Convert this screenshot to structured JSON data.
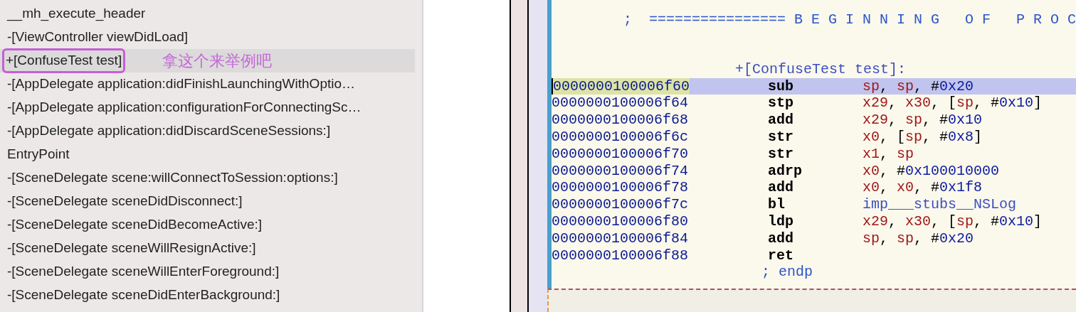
{
  "symbols": {
    "items": [
      {
        "label": "__mh_execute_header",
        "selected": false
      },
      {
        "label": "-[ViewController viewDidLoad]",
        "selected": false
      },
      {
        "label": "+[ConfuseTest test]",
        "selected": true,
        "circled": true,
        "note": "拿这个来举例吧"
      },
      {
        "label": "-[AppDelegate application:didFinishLaunchingWithOptio…",
        "selected": false
      },
      {
        "label": "-[AppDelegate application:configurationForConnectingSc…",
        "selected": false
      },
      {
        "label": "-[AppDelegate application:didDiscardSceneSessions:]",
        "selected": false
      },
      {
        "label": "EntryPoint",
        "selected": false
      },
      {
        "label": "-[SceneDelegate scene:willConnectToSession:options:]",
        "selected": false
      },
      {
        "label": "-[SceneDelegate sceneDidDisconnect:]",
        "selected": false
      },
      {
        "label": "-[SceneDelegate sceneDidBecomeActive:]",
        "selected": false
      },
      {
        "label": "-[SceneDelegate sceneWillResignActive:]",
        "selected": false
      },
      {
        "label": "-[SceneDelegate sceneWillEnterForeground:]",
        "selected": false
      },
      {
        "label": "-[SceneDelegate sceneDidEnterBackground:]",
        "selected": false
      }
    ]
  },
  "disassembly": {
    "banner": ";  ================ B E G I N N I N G   O F   P R O C",
    "procedure_label": "+[ConfuseTest test]:",
    "lines": [
      {
        "address": "0000000100006f60",
        "mnemonic": "sub",
        "selected": true,
        "operands": [
          {
            "text": "sp",
            "kind": "reg"
          },
          {
            "text": ", ",
            "kind": "punct"
          },
          {
            "text": "sp",
            "kind": "reg"
          },
          {
            "text": ", #",
            "kind": "punct"
          },
          {
            "text": "0x20",
            "kind": "imm"
          }
        ]
      },
      {
        "address": "0000000100006f64",
        "mnemonic": "stp",
        "selected": false,
        "operands": [
          {
            "text": "x29",
            "kind": "reg"
          },
          {
            "text": ", ",
            "kind": "punct"
          },
          {
            "text": "x30",
            "kind": "reg"
          },
          {
            "text": ", [",
            "kind": "punct"
          },
          {
            "text": "sp",
            "kind": "reg"
          },
          {
            "text": ", #",
            "kind": "punct"
          },
          {
            "text": "0x10",
            "kind": "imm"
          },
          {
            "text": "]",
            "kind": "punct"
          }
        ]
      },
      {
        "address": "0000000100006f68",
        "mnemonic": "add",
        "selected": false,
        "operands": [
          {
            "text": "x29",
            "kind": "reg"
          },
          {
            "text": ", ",
            "kind": "punct"
          },
          {
            "text": "sp",
            "kind": "reg"
          },
          {
            "text": ", #",
            "kind": "punct"
          },
          {
            "text": "0x10",
            "kind": "imm"
          }
        ]
      },
      {
        "address": "0000000100006f6c",
        "mnemonic": "str",
        "selected": false,
        "operands": [
          {
            "text": "x0",
            "kind": "reg"
          },
          {
            "text": ", [",
            "kind": "punct"
          },
          {
            "text": "sp",
            "kind": "reg"
          },
          {
            "text": ", #",
            "kind": "punct"
          },
          {
            "text": "0x8",
            "kind": "imm"
          },
          {
            "text": "]",
            "kind": "punct"
          }
        ]
      },
      {
        "address": "0000000100006f70",
        "mnemonic": "str",
        "selected": false,
        "operands": [
          {
            "text": "x1",
            "kind": "reg"
          },
          {
            "text": ", ",
            "kind": "punct"
          },
          {
            "text": "sp",
            "kind": "reg"
          }
        ]
      },
      {
        "address": "0000000100006f74",
        "mnemonic": "adrp",
        "selected": false,
        "operands": [
          {
            "text": "x0",
            "kind": "reg"
          },
          {
            "text": ", #",
            "kind": "punct"
          },
          {
            "text": "0x100010000",
            "kind": "imm"
          }
        ]
      },
      {
        "address": "0000000100006f78",
        "mnemonic": "add",
        "selected": false,
        "operands": [
          {
            "text": "x0",
            "kind": "reg"
          },
          {
            "text": ", ",
            "kind": "punct"
          },
          {
            "text": "x0",
            "kind": "reg"
          },
          {
            "text": ", #",
            "kind": "punct"
          },
          {
            "text": "0x1f8",
            "kind": "imm"
          }
        ]
      },
      {
        "address": "0000000100006f7c",
        "mnemonic": "bl",
        "selected": false,
        "operands": [
          {
            "text": "imp___stubs__NSLog",
            "kind": "sym"
          }
        ]
      },
      {
        "address": "0000000100006f80",
        "mnemonic": "ldp",
        "selected": false,
        "operands": [
          {
            "text": "x29",
            "kind": "reg"
          },
          {
            "text": ", ",
            "kind": "punct"
          },
          {
            "text": "x30",
            "kind": "reg"
          },
          {
            "text": ", [",
            "kind": "punct"
          },
          {
            "text": "sp",
            "kind": "reg"
          },
          {
            "text": ", #",
            "kind": "punct"
          },
          {
            "text": "0x10",
            "kind": "imm"
          },
          {
            "text": "]",
            "kind": "punct"
          }
        ]
      },
      {
        "address": "0000000100006f84",
        "mnemonic": "add",
        "selected": false,
        "operands": [
          {
            "text": "sp",
            "kind": "reg"
          },
          {
            "text": ", ",
            "kind": "punct"
          },
          {
            "text": "sp",
            "kind": "reg"
          },
          {
            "text": ", #",
            "kind": "punct"
          },
          {
            "text": "0x20",
            "kind": "imm"
          }
        ]
      },
      {
        "address": "0000000100006f88",
        "mnemonic": "ret",
        "selected": false
      }
    ],
    "end_label": "; endp"
  }
}
